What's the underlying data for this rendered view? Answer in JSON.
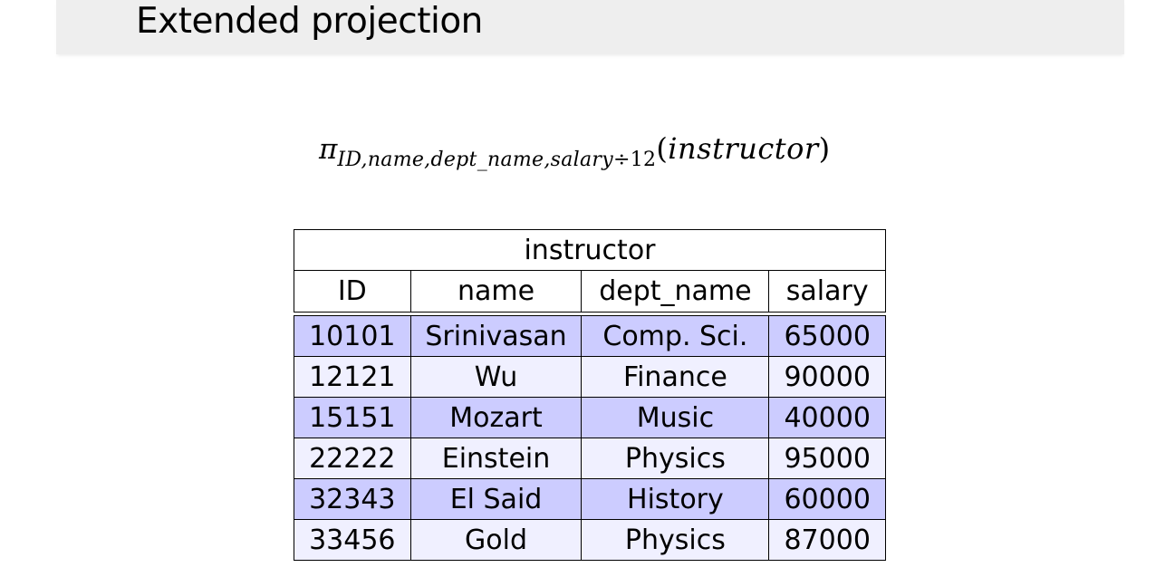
{
  "slide": {
    "title": "Extended projection"
  },
  "formula": {
    "operator": "π",
    "subscript_attrs": "ID,name,dept_name,salary",
    "subscript_op": "÷",
    "subscript_const": "12",
    "open_paren": "(",
    "relation": "instructor",
    "close_paren": ")"
  },
  "table": {
    "caption": "instructor",
    "columns": [
      "ID",
      "name",
      "dept_name",
      "salary"
    ],
    "rows": [
      [
        "10101",
        "Srinivasan",
        "Comp. Sci.",
        "65000"
      ],
      [
        "12121",
        "Wu",
        "Finance",
        "90000"
      ],
      [
        "15151",
        "Mozart",
        "Music",
        "40000"
      ],
      [
        "22222",
        "Einstein",
        "Physics",
        "95000"
      ],
      [
        "32343",
        "El Said",
        "History",
        "60000"
      ],
      [
        "33456",
        "Gold",
        "Physics",
        "87000"
      ]
    ]
  },
  "colors": {
    "title_bar_bg": "#eeeeee",
    "row_dark": "#ccccff",
    "row_light": "#f0f0ff"
  }
}
